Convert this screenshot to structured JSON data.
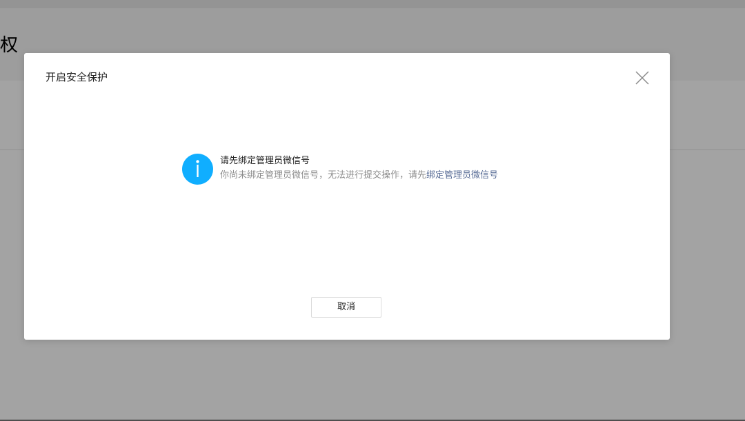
{
  "background": {
    "page_title_fragment": "权"
  },
  "dialog": {
    "title": "开启安全保护",
    "close_icon": "close-icon",
    "message": {
      "icon": "info-icon",
      "icon_color": "#10aeff",
      "title": "请先绑定管理员微信号",
      "description": "你尚未绑定管理员微信号，无法进行提交操作，请先",
      "link_text": "绑定管理员微信号",
      "link_color": "#576b95"
    },
    "cancel_label": "取消"
  }
}
